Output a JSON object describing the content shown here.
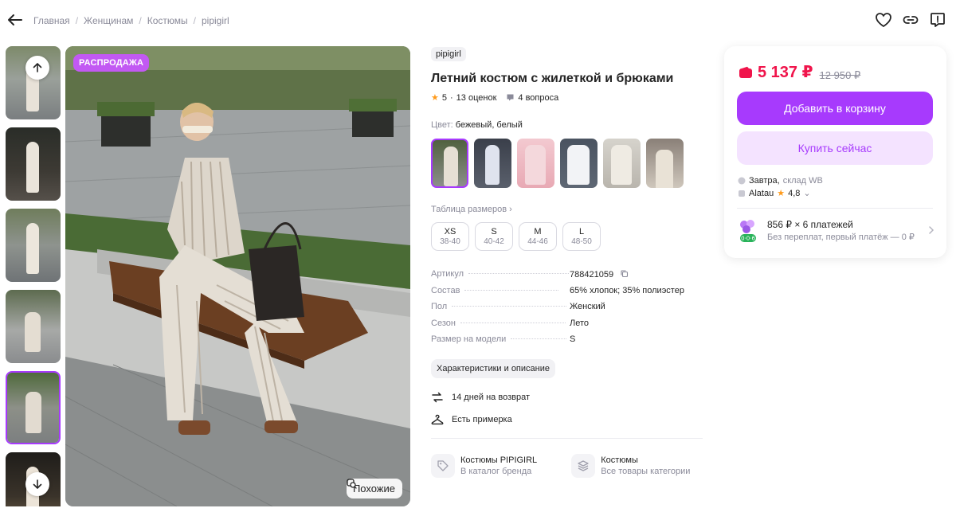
{
  "breadcrumb": [
    "Главная",
    "Женщинам",
    "Костюмы",
    "pipigirl"
  ],
  "icons": {
    "back": "arrow-left-icon",
    "favorite": "heart-icon",
    "share": "link-icon",
    "report": "report-icon"
  },
  "gallery": {
    "badge": "РАСПРОДАЖА",
    "similar_label": "Похожие",
    "thumb_count": 6,
    "active_thumb": 5
  },
  "product": {
    "brand": "pipigirl",
    "title": "Летний костюм с жилеткой и брюками",
    "rating": "5",
    "reviews": "13 оценок",
    "questions": "4 вопроса",
    "color_label": "Цвет:",
    "color_value": "бежевый, белый",
    "size_table": "Таблица размеров",
    "sizes": [
      {
        "size": "XS",
        "ru": "38-40"
      },
      {
        "size": "S",
        "ru": "40-42"
      },
      {
        "size": "M",
        "ru": "44-46"
      },
      {
        "size": "L",
        "ru": "48-50"
      }
    ],
    "specs": [
      {
        "key": "Артикул",
        "value": "788421059"
      },
      {
        "key": "Состав",
        "value": "65% хлопок; 35% полиэстер"
      },
      {
        "key": "Пол",
        "value": "Женский"
      },
      {
        "key": "Сезон",
        "value": "Лето"
      },
      {
        "key": "Размер на модели",
        "value": "S"
      }
    ],
    "chars_button": "Характеристики и описание",
    "return_text": "14 дней на возврат",
    "fitting_text": "Есть примерка",
    "brand_link": {
      "title": "Костюмы PIPIGIRL",
      "subtitle": "В каталог бренда"
    },
    "category_link": {
      "title": "Костюмы",
      "subtitle": "Все товары категории"
    }
  },
  "buy": {
    "price": "5 137 ₽",
    "old_price": "12 950 ₽",
    "add_to_cart": "Добавить в корзину",
    "buy_now": "Купить сейчас",
    "delivery_day": "Завтра,",
    "delivery_place": "склад WB",
    "seller": "Alatau",
    "seller_rating": "4,8",
    "installment_title": "856 ₽ × 6 платежей",
    "installment_sub": "Без переплат, первый платёж — 0 ₽",
    "installment_badge": "0·0·6"
  },
  "colors": {
    "accent": "#a73afd",
    "price": "#f0144b",
    "star": "#ff9a1b",
    "badge": "#c259f3"
  }
}
